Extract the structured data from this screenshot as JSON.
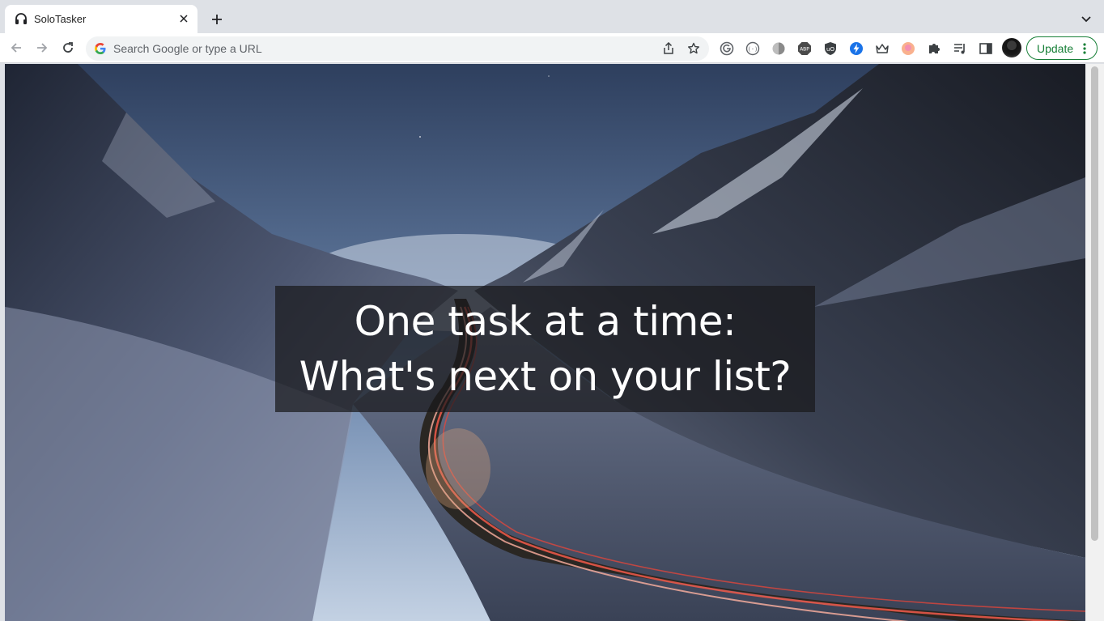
{
  "browser": {
    "tab": {
      "title": "SoloTasker",
      "favicon": "headphones-icon"
    },
    "omnibox": {
      "placeholder": "Search Google or type a URL"
    },
    "update_label": "Update",
    "extensions": [
      "grammarly-icon",
      "code-icon",
      "dark-mode-icon",
      "adblock-icon",
      "ublock-icon",
      "lightning-icon",
      "crown-icon",
      "peach-icon",
      "puzzle-icon",
      "reading-list-icon",
      "side-panel-icon"
    ],
    "accent_color": "#188038"
  },
  "page": {
    "headline": "One task at a time: What's next on your list?",
    "background": "snowy-mountain-valley-road-at-dusk"
  }
}
